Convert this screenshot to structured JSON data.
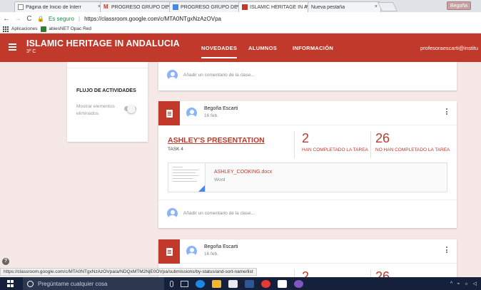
{
  "browser": {
    "tabs": [
      {
        "title": "Página de Inicio de Interr",
        "icon": "page-icon",
        "active": false
      },
      {
        "title": "PROGRESO GRUPO DE T",
        "icon": "gmail-icon",
        "active": false
      },
      {
        "title": "PROGRESO GRUPO DE T",
        "icon": "docs-icon",
        "active": false
      },
      {
        "title": "ISLAMIC HERITAGE IN A",
        "icon": "classroom-icon",
        "active": true
      },
      {
        "title": "Nueva pestaña",
        "icon": "",
        "active": false
      }
    ],
    "close_glyph": "×",
    "user_chip": "Begoña",
    "secure_label": "Es seguro",
    "url": "https://classroom.google.com/c/MTA0NTgxNzAzOVpa",
    "bookmarks": [
      {
        "label": "Aplicaciones",
        "icon": "apps-grid-icon"
      },
      {
        "label": "abiesNET Opac Red",
        "icon": "abies-icon"
      }
    ],
    "status_url": "https://classroom.google.com/c/MTA0NTgxNzAzOVpa/a/NDQxMTM2NjE0OVpa/submissions/by-status/and-sort-name/list"
  },
  "classroom": {
    "class_name": "ISLAMIC HERITAGE IN ANDALUCIA",
    "section": "3º C",
    "nav": [
      {
        "label": "NOVEDADES",
        "active": true
      },
      {
        "label": "ALUMNOS",
        "active": false
      },
      {
        "label": "INFORMACIÓN",
        "active": false
      }
    ],
    "account": "profesoraescarti@institu",
    "accent_color": "#c0392b"
  },
  "sidebar": {
    "flujo_title": "FLUJO DE ACTIVIDADES",
    "flujo_toggle_label": "Mostrar elementos eliminados",
    "flujo_toggle_on": false
  },
  "stream": {
    "comment_placeholder": "Añadir un comentario de la clase...",
    "posts": [
      {
        "author": "Begoña Escarti",
        "date": "16 feb.",
        "title": "ASHLEY'S PRESENTATION",
        "subtitle": "TASK 4",
        "done_count": "2",
        "done_label": "HAN COMPLETADO LA TAREA",
        "not_done_count": "26",
        "not_done_label": "NO HAN COMPLETADO LA TAREA",
        "attachment": {
          "name": "ASHLEY_COOKING.docx",
          "type": "Word"
        }
      },
      {
        "author": "Begoña Escarti",
        "date": "16 feb.",
        "done_count": "2",
        "not_done_count": "26"
      }
    ]
  },
  "taskbar": {
    "search_placeholder": "Pregúntame cualquier cosa",
    "tray_text": "^ ⌁ ☼ ◁"
  }
}
